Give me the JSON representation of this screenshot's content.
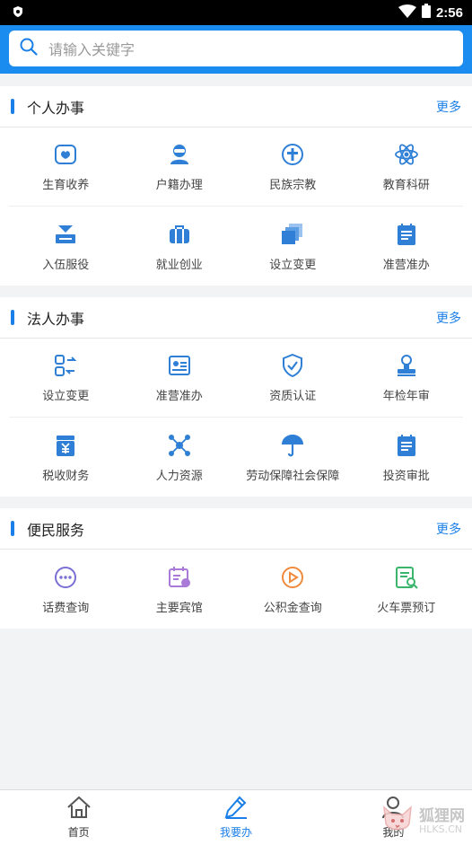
{
  "status": {
    "time": "2:56"
  },
  "search": {
    "placeholder": "请输入关键字"
  },
  "sections": [
    {
      "title": "个人办事",
      "more": "更多",
      "rows": [
        [
          {
            "label": "生育收养",
            "icon": "birth-icon"
          },
          {
            "label": "户籍办理",
            "icon": "household-icon"
          },
          {
            "label": "民族宗教",
            "icon": "religion-icon"
          },
          {
            "label": "教育科研",
            "icon": "atom-icon"
          }
        ],
        [
          {
            "label": "入伍服役",
            "icon": "military-icon"
          },
          {
            "label": "就业创业",
            "icon": "briefcase-icon"
          },
          {
            "label": "设立变更",
            "icon": "stack-icon"
          },
          {
            "label": "准营准办",
            "icon": "license-icon"
          }
        ]
      ]
    },
    {
      "title": "法人办事",
      "more": "更多",
      "rows": [
        [
          {
            "label": "设立变更",
            "icon": "exchange-icon"
          },
          {
            "label": "准营准办",
            "icon": "id-card-icon"
          },
          {
            "label": "资质认证",
            "icon": "shield-check-icon"
          },
          {
            "label": "年检年审",
            "icon": "stamp-icon"
          }
        ],
        [
          {
            "label": "税收财务",
            "icon": "tax-icon"
          },
          {
            "label": "人力资源",
            "icon": "network-icon"
          },
          {
            "label": "劳动保障社会保障",
            "icon": "umbrella-icon"
          },
          {
            "label": "投资审批",
            "icon": "clipboard-icon"
          }
        ]
      ]
    },
    {
      "title": "便民服务",
      "more": "更多",
      "rows": [
        [
          {
            "label": "话费查询",
            "icon": "chat-icon"
          },
          {
            "label": "主要宾馆",
            "icon": "calendar-icon"
          },
          {
            "label": "公积金查询",
            "icon": "play-circle-icon"
          },
          {
            "label": "火车票预订",
            "icon": "ticket-search-icon"
          }
        ]
      ]
    }
  ],
  "tabs": [
    {
      "label": "首页",
      "icon": "home-icon"
    },
    {
      "label": "我要办",
      "icon": "pen-icon",
      "active": true
    },
    {
      "label": "我的",
      "icon": "user-icon"
    }
  ],
  "watermark": {
    "line1": "狐狸网",
    "line2": "HLKS.CN"
  },
  "colors": {
    "accent": "#1a7fe8",
    "header": "#1a8cf0",
    "icon_blue": "#2f7fd6",
    "icon_purple": "#7a6fd3",
    "icon_orange": "#f08a3c",
    "icon_green": "#3bb56b"
  }
}
